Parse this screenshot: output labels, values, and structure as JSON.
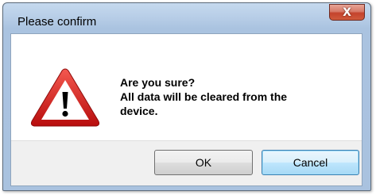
{
  "window": {
    "title": "Please confirm",
    "close_glyph": "X"
  },
  "dialog": {
    "icon": "warning-triangle-icon",
    "message_line1": "Are you sure?",
    "message_line2": "All data will be cleared from the",
    "message_line3": "device."
  },
  "buttons": {
    "ok_label": "OK",
    "cancel_label": "Cancel"
  },
  "colors": {
    "warning_red": "#d11a1a",
    "close_button": "#c4432c",
    "focused_button_border": "#3c7fb1"
  }
}
